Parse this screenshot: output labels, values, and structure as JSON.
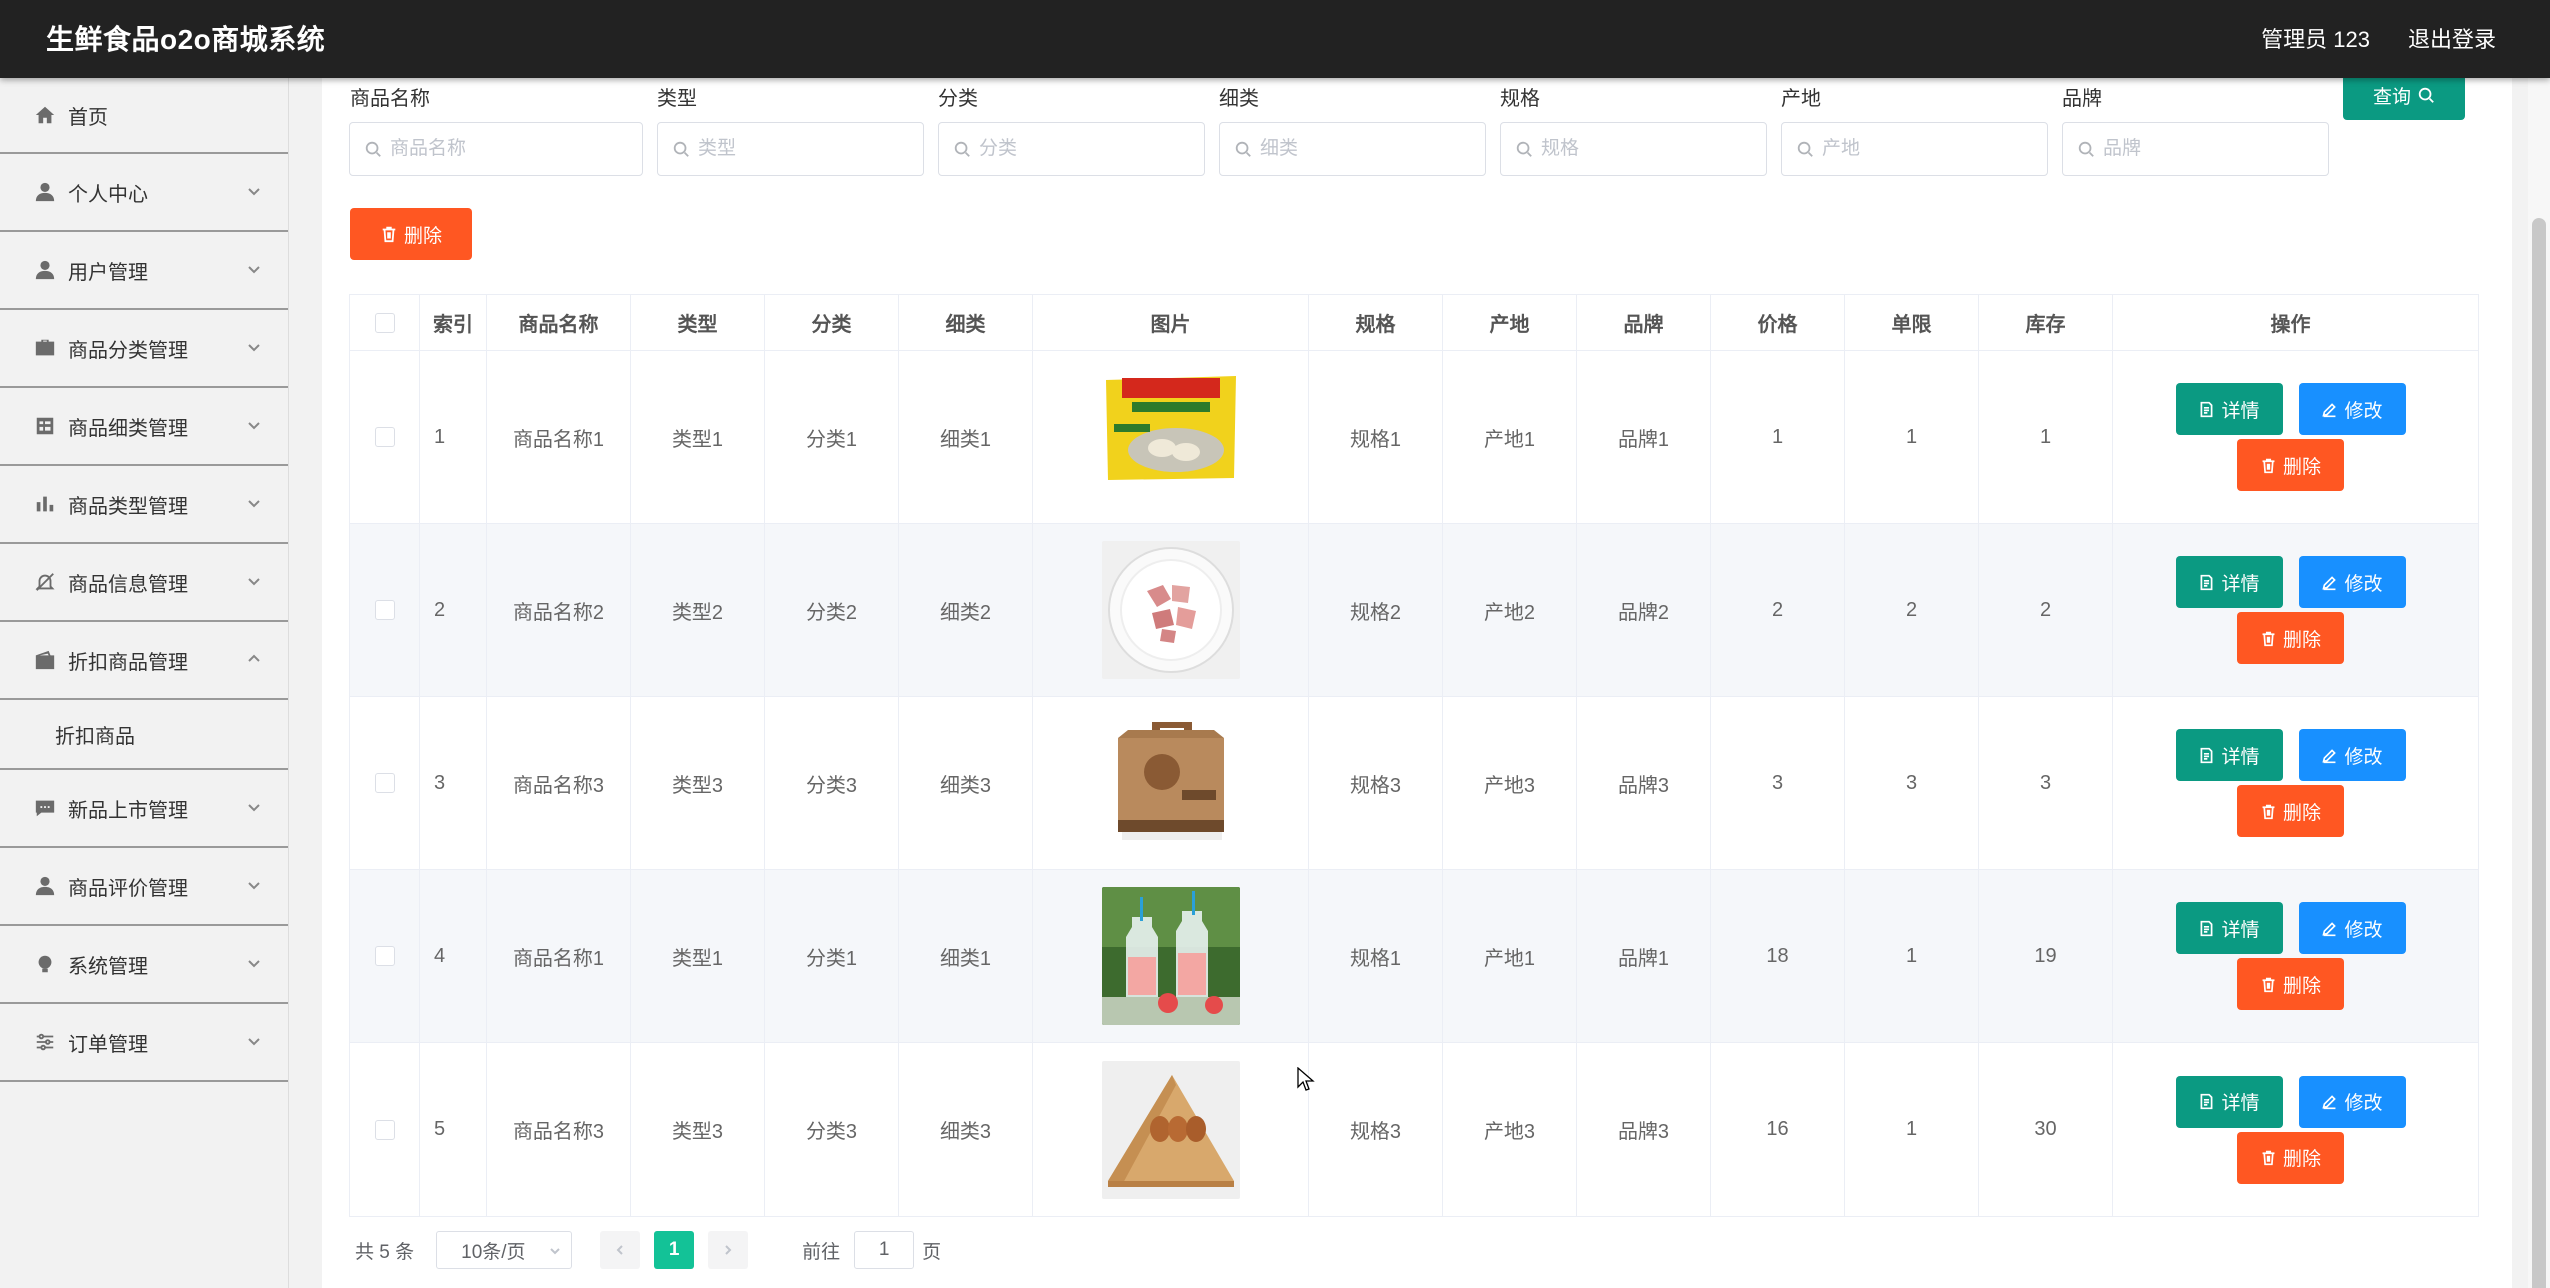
{
  "app": {
    "title": "生鲜食品o2o商城系统",
    "user": "管理员 123",
    "logout": "退出登录"
  },
  "sidebar": {
    "items": [
      {
        "label": "首页",
        "icon": "home-icon"
      },
      {
        "label": "个人中心",
        "icon": "user-icon"
      },
      {
        "label": "用户管理",
        "icon": "user-icon"
      },
      {
        "label": "商品分类管理",
        "icon": "briefcase-icon"
      },
      {
        "label": "商品细类管理",
        "icon": "grid-icon"
      },
      {
        "label": "商品类型管理",
        "icon": "bar-chart-icon"
      },
      {
        "label": "商品信息管理",
        "icon": "bell-off-icon"
      },
      {
        "label": "折扣商品管理",
        "icon": "wallet-icon",
        "expanded": true
      },
      {
        "label": "新品上市管理",
        "icon": "chat-icon"
      },
      {
        "label": "商品评价管理",
        "icon": "user-icon"
      },
      {
        "label": "系统管理",
        "icon": "bulb-icon"
      },
      {
        "label": "订单管理",
        "icon": "sliders-icon"
      }
    ],
    "sub_item": "折扣商品"
  },
  "filters": [
    {
      "label": "商品名称",
      "placeholder": "商品名称"
    },
    {
      "label": "类型",
      "placeholder": "类型"
    },
    {
      "label": "分类",
      "placeholder": "分类"
    },
    {
      "label": "细类",
      "placeholder": "细类"
    },
    {
      "label": "规格",
      "placeholder": "规格"
    },
    {
      "label": "产地",
      "placeholder": "产地"
    },
    {
      "label": "品牌",
      "placeholder": "品牌"
    }
  ],
  "buttons": {
    "query": "查询",
    "delete": "删除",
    "detail": "详情",
    "edit": "修改"
  },
  "table": {
    "headers": [
      "索引",
      "商品名称",
      "类型",
      "分类",
      "细类",
      "图片",
      "规格",
      "产地",
      "品牌",
      "价格",
      "单限",
      "库存",
      "操作"
    ],
    "rows": [
      {
        "index": "1",
        "name": "商品名称1",
        "type": "类型1",
        "category": "分类1",
        "subcategory": "细类1",
        "image": "dumpling-package",
        "spec": "规格1",
        "origin": "产地1",
        "brand": "品牌1",
        "price": "1",
        "limit": "1",
        "stock": "1"
      },
      {
        "index": "2",
        "name": "商品名称2",
        "type": "类型2",
        "category": "分类2",
        "subcategory": "细类2",
        "image": "meat-plate",
        "spec": "规格2",
        "origin": "产地2",
        "brand": "品牌2",
        "price": "2",
        "limit": "2",
        "stock": "2"
      },
      {
        "index": "3",
        "name": "商品名称3",
        "type": "类型3",
        "category": "分类3",
        "subcategory": "细类3",
        "image": "gift-box",
        "spec": "规格3",
        "origin": "产地3",
        "brand": "品牌3",
        "price": "3",
        "limit": "3",
        "stock": "3"
      },
      {
        "index": "4",
        "name": "商品名称1",
        "type": "类型1",
        "category": "分类1",
        "subcategory": "细类1",
        "image": "drink-bottles",
        "spec": "规格1",
        "origin": "产地1",
        "brand": "品牌1",
        "price": "18",
        "limit": "1",
        "stock": "19"
      },
      {
        "index": "5",
        "name": "商品名称3",
        "type": "类型3",
        "category": "分类3",
        "subcategory": "细类3",
        "image": "egg-box",
        "spec": "规格3",
        "origin": "产地3",
        "brand": "品牌3",
        "price": "16",
        "limit": "1",
        "stock": "30"
      }
    ]
  },
  "pagination": {
    "total": "共 5 条",
    "page_size": "10条/页",
    "current_page": "1",
    "goto_label": "前往",
    "goto_value": "1",
    "page_suffix": "页"
  },
  "colors": {
    "topbar": "#222222",
    "detail": "#0b9a82",
    "edit": "#1890ff",
    "delete": "#ff5722",
    "page_active": "#13c297"
  }
}
